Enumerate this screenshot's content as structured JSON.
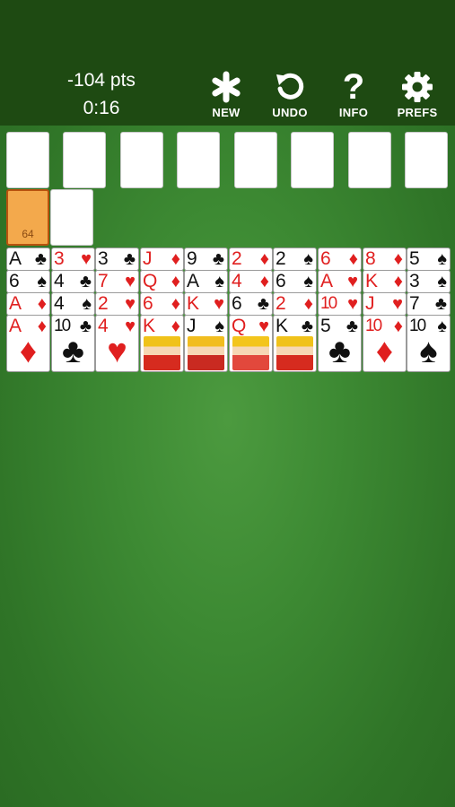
{
  "header": {
    "score": "-104 pts",
    "time": "0:16",
    "buttons": [
      {
        "label": "NEW",
        "icon": "asterisk-icon"
      },
      {
        "label": "UNDO",
        "icon": "undo-icon"
      },
      {
        "label": "INFO",
        "icon": "question-icon"
      },
      {
        "label": "PREFS",
        "icon": "gear-icon"
      }
    ]
  },
  "foundation_slots": 8,
  "stock": {
    "count": "64"
  },
  "colors": {
    "header": "#1e4a12",
    "table": "#3d8a33",
    "red_suit": "#e01f1f",
    "stock": "#f3a94c"
  },
  "tableau": [
    [
      "A♣",
      "6♠",
      "A♦",
      "A♦"
    ],
    [
      "3♥",
      "4♣",
      "4♠",
      "10♣"
    ],
    [
      "3♣",
      "7♥",
      "2♥",
      "4♥"
    ],
    [
      "J♦",
      "Q♦",
      "6♦",
      "K♦"
    ],
    [
      "9♣",
      "A♠",
      "K♥",
      "J♠"
    ],
    [
      "2♦",
      "4♦",
      "6♣",
      "Q♥"
    ],
    [
      "2♠",
      "6♠",
      "2♦",
      "K♣"
    ],
    [
      "6♦",
      "A♥",
      "10♥",
      "5♣"
    ],
    [
      "8♦",
      "K♦",
      "J♥",
      "10♦"
    ],
    [
      "5♠",
      "3♠",
      "7♣",
      "10♠"
    ]
  ]
}
